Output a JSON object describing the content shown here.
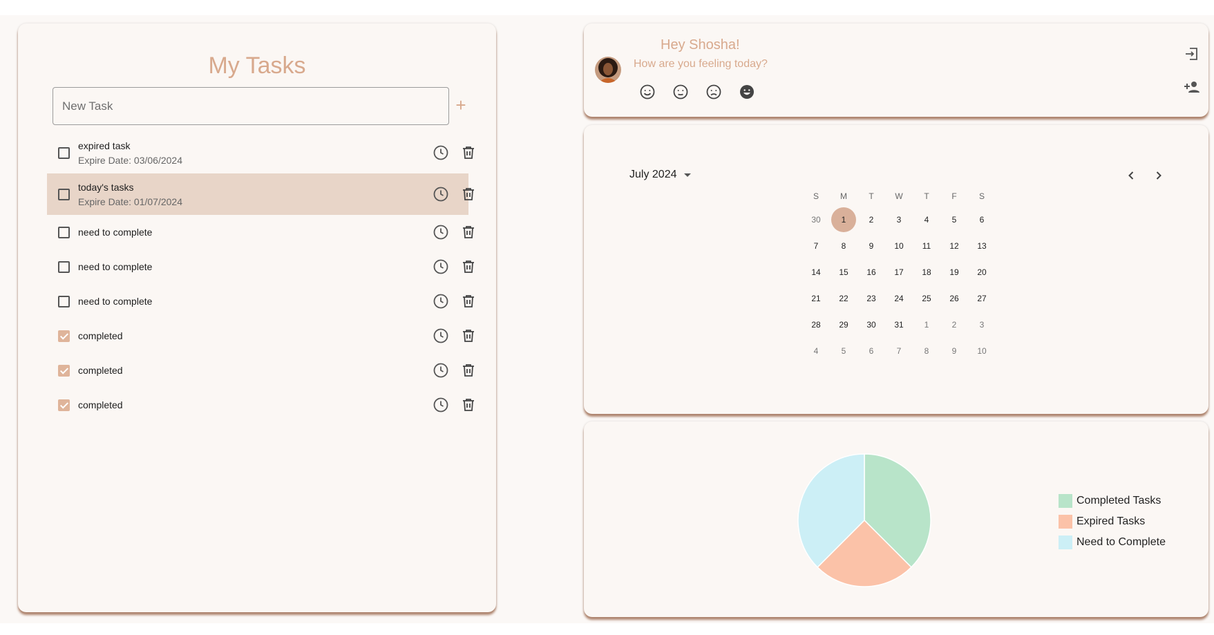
{
  "tasks": {
    "title": "My Tasks",
    "new_task_placeholder": "New Task",
    "add_label": "+",
    "items": [
      {
        "name": "expired task",
        "date": "Expire Date: 03/06/2024",
        "checked": false
      },
      {
        "name": "today's tasks",
        "date": "Expire Date: 01/07/2024",
        "checked": false,
        "highlighted": true
      },
      {
        "name": "need to complete",
        "checked": false
      },
      {
        "name": "need to complete",
        "checked": false
      },
      {
        "name": "need to complete",
        "checked": false
      },
      {
        "name": "completed",
        "checked": true
      },
      {
        "name": "completed",
        "checked": true
      },
      {
        "name": "completed",
        "checked": true
      }
    ]
  },
  "greeting": {
    "title": "Hey Shosha!",
    "subtitle": "How are you feeling today?",
    "moods": [
      "smile-icon",
      "neutral-icon",
      "sad-icon",
      "laugh-icon"
    ]
  },
  "calendar": {
    "month_label": "July 2024",
    "weekdays": [
      "S",
      "M",
      "T",
      "W",
      "T",
      "F",
      "S"
    ],
    "selected_day": "1",
    "weeks": [
      [
        "30",
        "1",
        "2",
        "3",
        "4",
        "5",
        "6"
      ],
      [
        "7",
        "8",
        "9",
        "10",
        "11",
        "12",
        "13"
      ],
      [
        "14",
        "15",
        "16",
        "17",
        "18",
        "19",
        "20"
      ],
      [
        "21",
        "22",
        "23",
        "24",
        "25",
        "26",
        "27"
      ],
      [
        "28",
        "29",
        "30",
        "31",
        "1",
        "2",
        "3"
      ],
      [
        "4",
        "5",
        "6",
        "7",
        "8",
        "9",
        "10"
      ]
    ]
  },
  "chart_data": {
    "type": "pie",
    "slices": [
      {
        "label": "Completed Tasks",
        "value": 3,
        "color": "#b8e4c9"
      },
      {
        "label": "Expired Tasks",
        "value": 2,
        "color": "#fbc2a8"
      },
      {
        "label": "Need to Complete",
        "value": 3,
        "color": "#cceff6"
      }
    ],
    "legend_position": "right"
  },
  "colors": {
    "accent": "#d8a98d",
    "highlight_row": "#e8d5c8",
    "checkbox_checked": "#dfb49a",
    "card_bg": "#fbf7f4"
  }
}
